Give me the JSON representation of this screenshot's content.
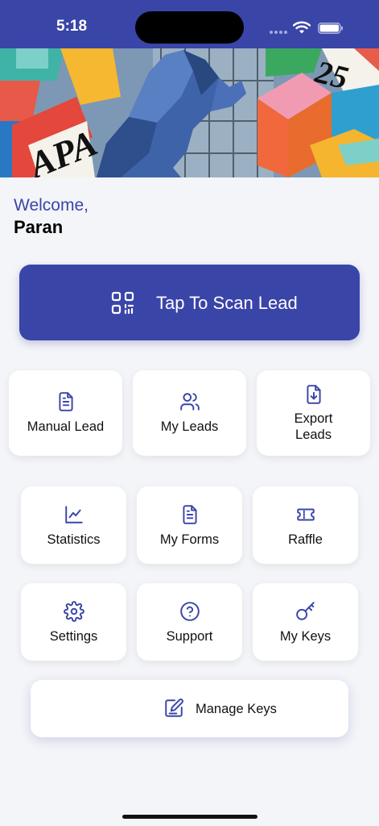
{
  "status_bar": {
    "time": "5:18"
  },
  "banner": {
    "sign_left": "APA",
    "sign_right": "25"
  },
  "welcome": {
    "greeting": "Welcome,",
    "name": "Paran"
  },
  "scan": {
    "label": "Tap To Scan Lead",
    "icon": "qr-code-icon"
  },
  "tiles": [
    {
      "label_line1": "Manual Lead",
      "label_line2": "",
      "icon": "document-icon"
    },
    {
      "label_line1": "My Leads",
      "label_line2": "",
      "icon": "users-icon"
    },
    {
      "label_line1": "Export",
      "label_line2": "Leads",
      "icon": "file-download-icon"
    },
    {
      "label_line1": "Statistics",
      "label_line2": "",
      "icon": "line-chart-icon"
    },
    {
      "label_line1": "My Forms",
      "label_line2": "",
      "icon": "document-icon"
    },
    {
      "label_line1": "Raffle",
      "label_line2": "",
      "icon": "ticket-icon"
    },
    {
      "label_line1": "Settings",
      "label_line2": "",
      "icon": "gear-icon"
    },
    {
      "label_line1": "Support",
      "label_line2": "",
      "icon": "help-circle-icon"
    },
    {
      "label_line1": "My Keys",
      "label_line2": "",
      "icon": "key-icon"
    }
  ],
  "manage_keys": {
    "label": "Manage Keys",
    "icon": "edit-note-icon"
  },
  "colors": {
    "primary": "#3a45a8",
    "background": "#f4f5f9",
    "tile": "#ffffff"
  }
}
